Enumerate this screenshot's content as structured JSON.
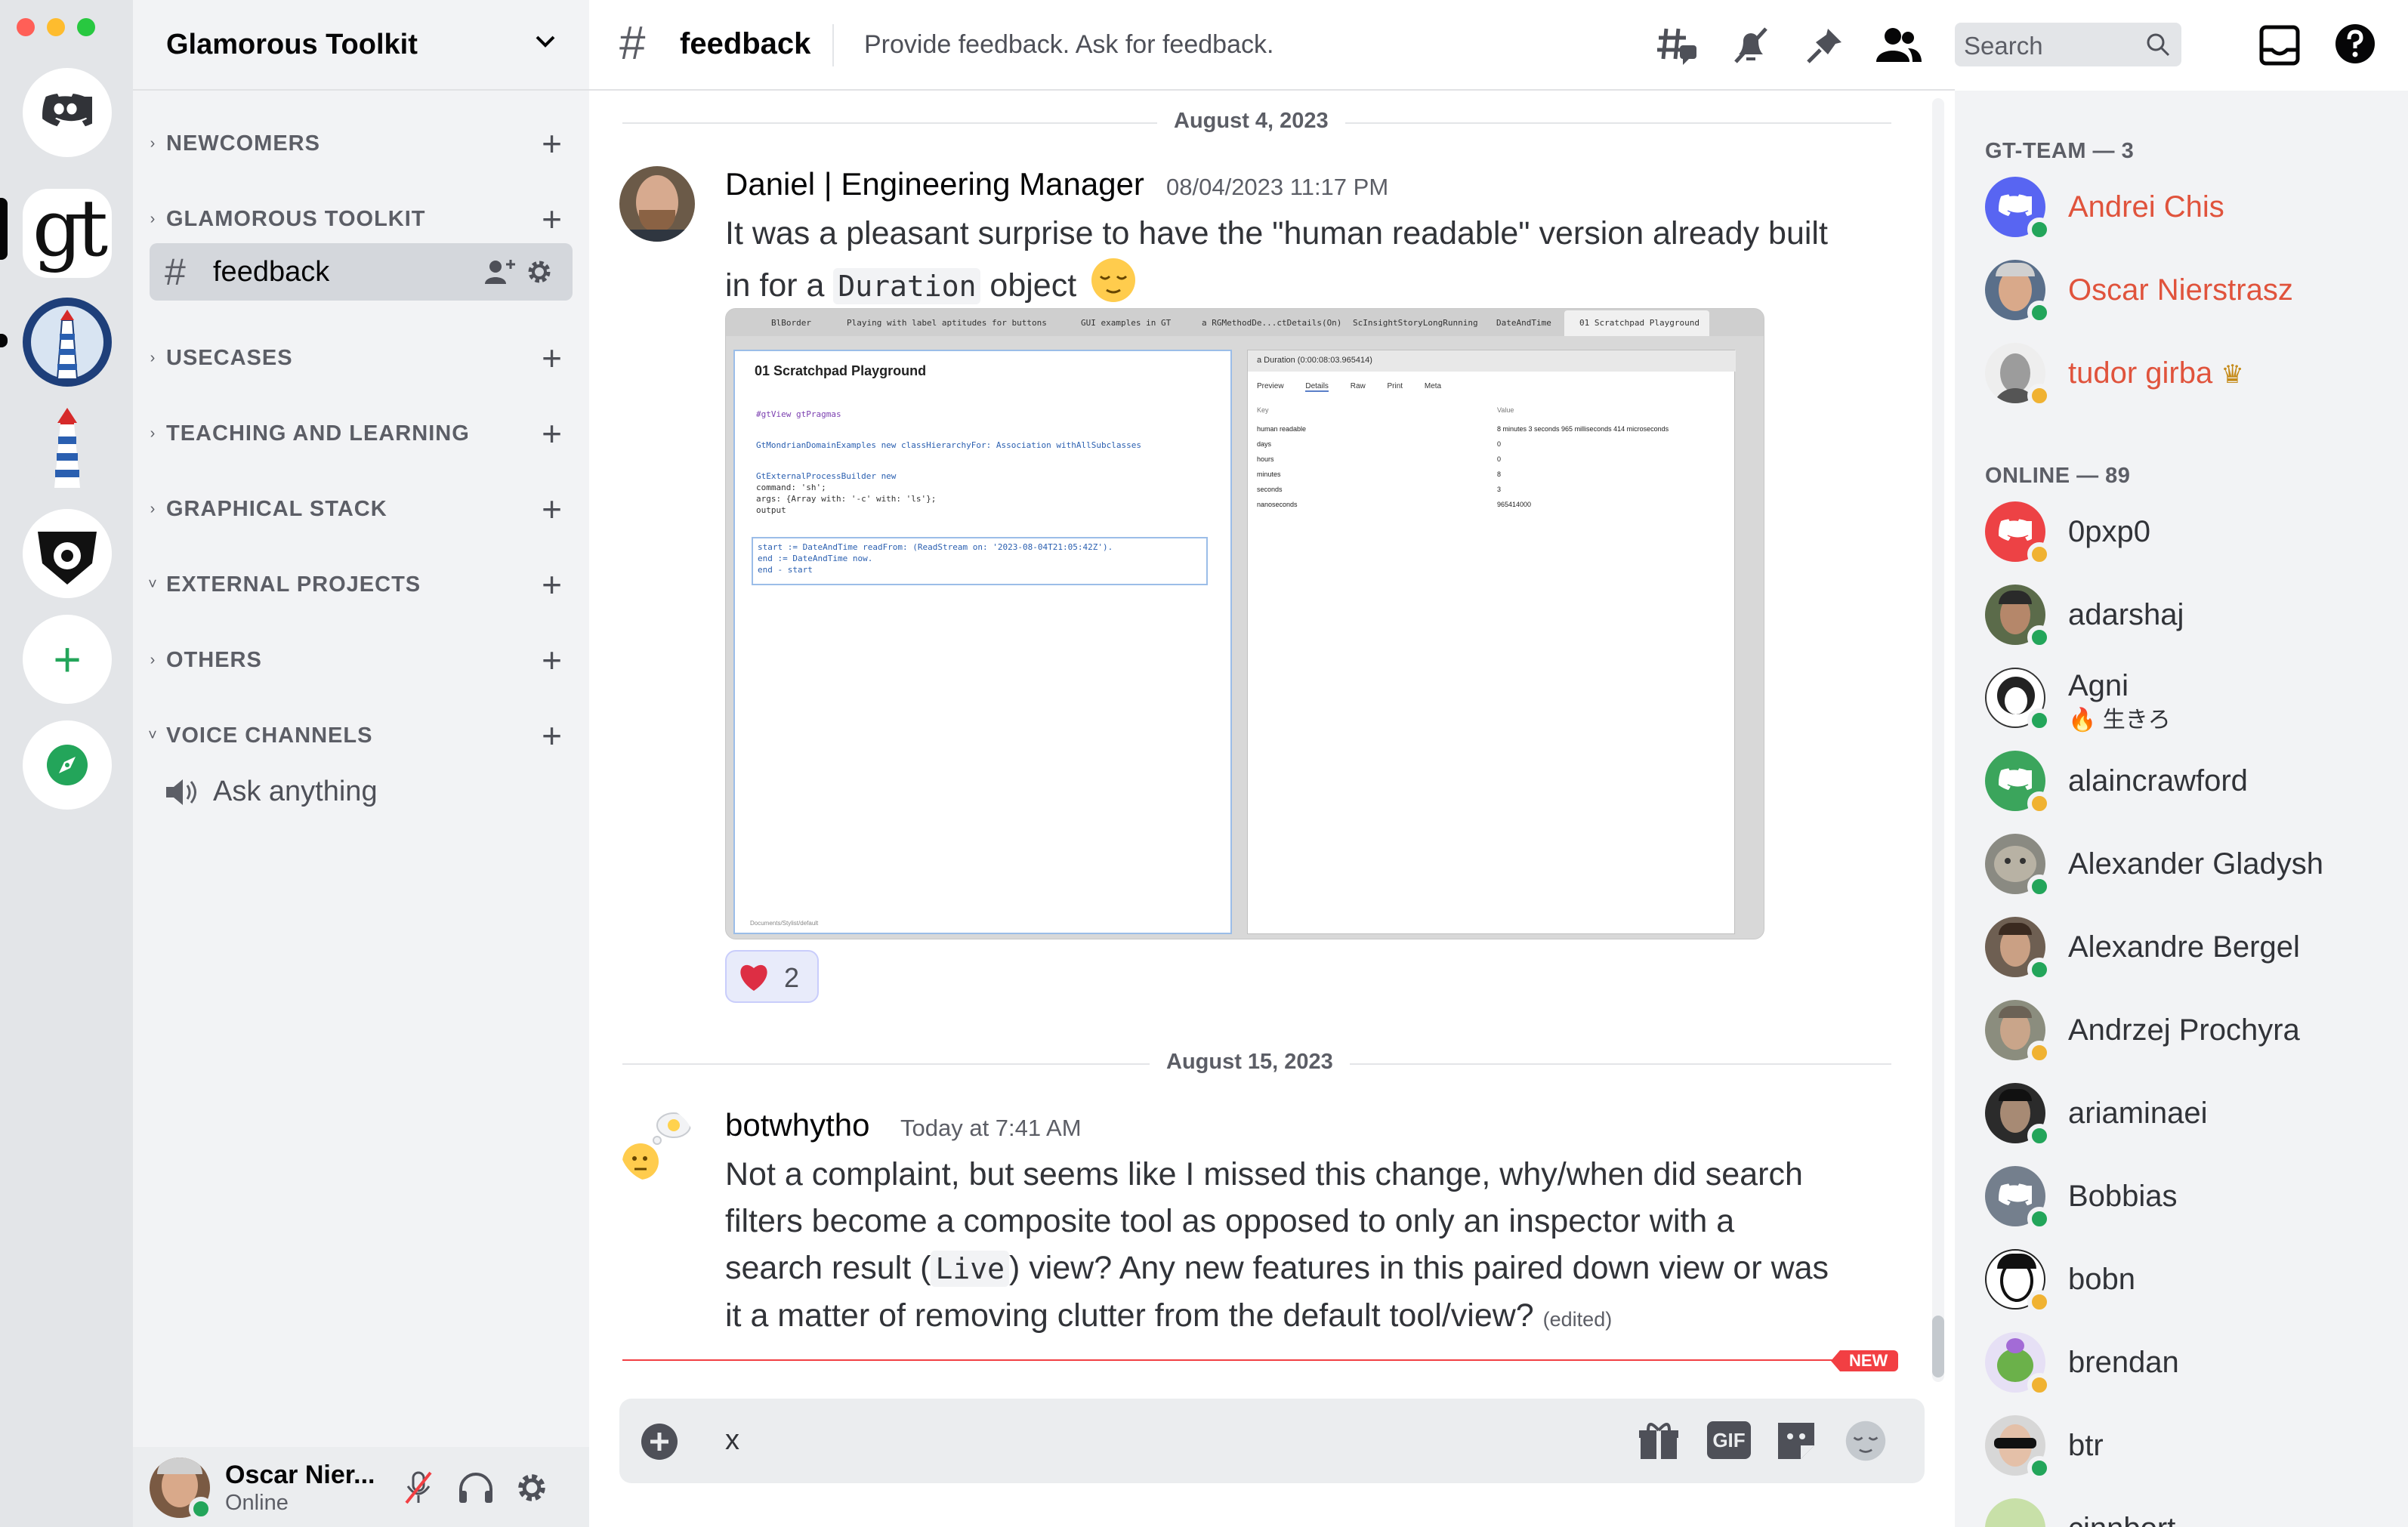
{
  "guild": {
    "name": "Glamorous Toolkit"
  },
  "sidebar": {
    "categories": [
      {
        "label": "NEWCOMERS",
        "expanded": false
      },
      {
        "label": "GLAMOROUS TOOLKIT",
        "expanded": false
      },
      {
        "label": "USECASES",
        "expanded": false
      },
      {
        "label": "TEACHING AND LEARNING",
        "expanded": false
      },
      {
        "label": "GRAPHICAL STACK",
        "expanded": false
      },
      {
        "label": "EXTERNAL PROJECTS",
        "expanded": true
      },
      {
        "label": "OTHERS",
        "expanded": false
      },
      {
        "label": "VOICE CHANNELS",
        "expanded": true
      }
    ],
    "active_channel": "feedback",
    "voice_channel": "Ask anything"
  },
  "user_panel": {
    "name": "Oscar Nier...",
    "status": "Online"
  },
  "channel": {
    "name": "feedback",
    "topic": "Provide feedback. Ask for feedback.",
    "search_placeholder": "Search"
  },
  "messages": [
    {
      "date": "August 4, 2023",
      "author": "Daniel | Engineering Manager",
      "time": "08/04/2023 11:17 PM",
      "text_a": "It was a pleasant surprise to have the \"human readable\" version already built",
      "text_b": "in for a",
      "code": "Duration",
      "text_c": "object",
      "reaction_count": "2"
    },
    {
      "date": "August 15, 2023",
      "author": "botwhytho",
      "time": "Today at 7:41 AM",
      "line1": "Not a complaint, but seems like I missed this change, why/when did search",
      "line2": "filters become a composite tool as opposed to only an inspector with a",
      "line3a": "search result (",
      "code": "Live",
      "line3b": ") view? Any new features in this paired down view or was",
      "line4": "it a matter of removing clutter from the default tool/view?",
      "edited": "(edited)"
    }
  ],
  "new_badge": "NEW",
  "composer": {
    "value": "x",
    "gif_label": "GIF"
  },
  "screenshot": {
    "tabs": [
      "BlBorder",
      "Playing with label aptitudes for buttons",
      "GUI examples in GT",
      "a RGMethodDe...ctDetails(On)",
      "ScInsightStoryLongRunning",
      "DateAndTime",
      "01 Scratchpad Playground"
    ],
    "left_title": "01 Scratchpad Playground",
    "right_title": "a Duration (0:00:08:03.965414)",
    "right_tabs": [
      "Preview",
      "Details",
      "Raw",
      "Print",
      "Meta"
    ],
    "col_key": "Key",
    "col_value": "Value",
    "rows": [
      {
        "key": "human readable",
        "value": "8 minutes 3 seconds 965 milliseconds 414 microseconds"
      },
      {
        "key": "days",
        "value": "0"
      },
      {
        "key": "hours",
        "value": "0"
      },
      {
        "key": "minutes",
        "value": "8"
      },
      {
        "key": "seconds",
        "value": "3"
      },
      {
        "key": "nanoseconds",
        "value": "965414000"
      }
    ],
    "code_lines": [
      "#gtView gtPragmas",
      "GtMondrianDomainExamples new classHierarchyFor: Association withAllSubclasses",
      "GtExternalProcessBuilder new",
      "    command: 'sh';",
      "    args: {Array with: '-c' with: 'ls'};",
      "    output",
      "start := DateAndTime readFrom: (ReadStream on: '2023-08-04T21:05:42Z').",
      "end := DateAndTime now.",
      "end - start"
    ],
    "footer": "Documents/Stylist/default"
  },
  "members": {
    "team_header": "GT-TEAM — 3",
    "online_header": "ONLINE — 89",
    "team": [
      {
        "name": "Andrei Chis",
        "color": "#e0533c"
      },
      {
        "name": "Oscar Nierstrasz",
        "color": "#e0533c"
      },
      {
        "name": "tudor girba",
        "color": "#e0533c",
        "crown": "♛"
      }
    ],
    "online": [
      {
        "name": "0pxp0"
      },
      {
        "name": "adarshaj"
      },
      {
        "name": "Agni",
        "sub": "🔥 生きろ"
      },
      {
        "name": "alaincrawford"
      },
      {
        "name": "Alexander Gladysh"
      },
      {
        "name": "Alexandre Bergel"
      },
      {
        "name": "Andrzej Prochyra"
      },
      {
        "name": "ariaminaei"
      },
      {
        "name": "Bobbias"
      },
      {
        "name": "bobn"
      },
      {
        "name": "brendan"
      },
      {
        "name": "btr"
      },
      {
        "name": "cinnbort"
      }
    ]
  },
  "colors": {
    "accent": "#5865f2",
    "online": "#23a55a",
    "idle": "#f0b232",
    "new_red": "#f23f43",
    "reaction_bg": "#e8ebfa"
  }
}
